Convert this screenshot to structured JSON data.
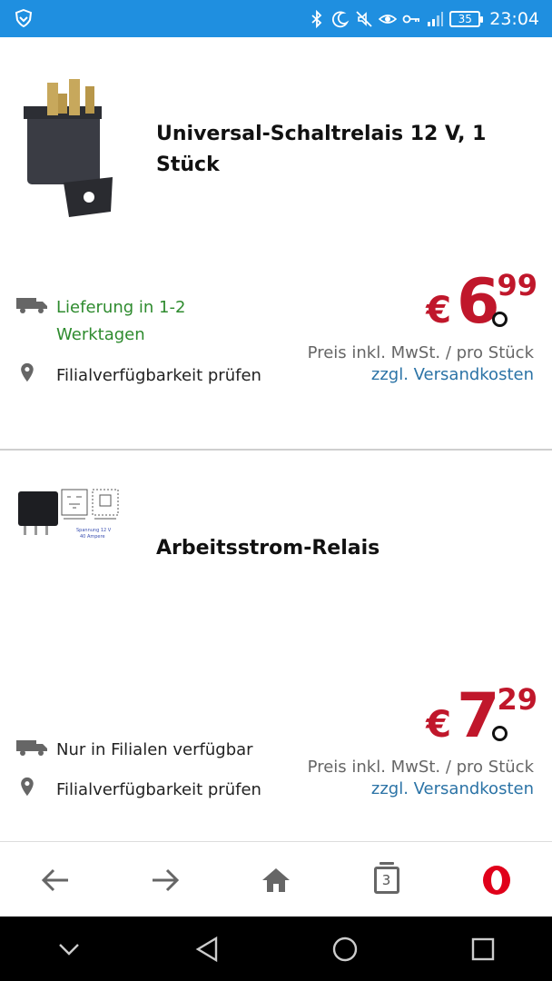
{
  "status_bar": {
    "battery": "35",
    "time": "23:04",
    "icons": [
      "shield-icon",
      "bluetooth-icon",
      "moon-icon",
      "mute-icon",
      "eye-icon",
      "key-icon",
      "signal-icon",
      "battery-icon"
    ]
  },
  "products": [
    {
      "title": "Universal-Schaltrelais 12 V, 1 Stück",
      "image_icon": "relay-product-image",
      "delivery_text": "Lieferung in 1-2 Werktagen",
      "availability_text": "Filialverfügbarkeit prüfen",
      "price_currency": "€",
      "price_main": "6",
      "price_cents": "99",
      "price_note": "Preis inkl. MwSt. / pro Stück",
      "shipping_link": "zzgl. Versandkosten",
      "colors": {
        "delivery": "#2e8b2e"
      }
    },
    {
      "title": "Arbeitsstrom-Relais",
      "image_icon": "relay-with-diagram-image",
      "image_caption_line1": "Spannung 12 V",
      "image_caption_line2": "40 Ampere",
      "delivery_text": "Nur in Filialen verfügbar",
      "availability_text": "Filialverfügbarkeit prüfen",
      "price_currency": "€",
      "price_main": "7",
      "price_cents": "29",
      "price_note": "Preis inkl. MwSt. / pro Stück",
      "shipping_link": "zzgl. Versandkosten"
    }
  ],
  "browser_nav": {
    "tabs_count": "3",
    "icons": [
      "back-arrow-icon",
      "forward-arrow-icon",
      "home-icon",
      "tabs-icon",
      "opera-icon"
    ]
  },
  "colors": {
    "status_bar": "#1f8fe0",
    "price": "#c0172b",
    "link": "#2b73a6",
    "opera": "#e0001a"
  }
}
